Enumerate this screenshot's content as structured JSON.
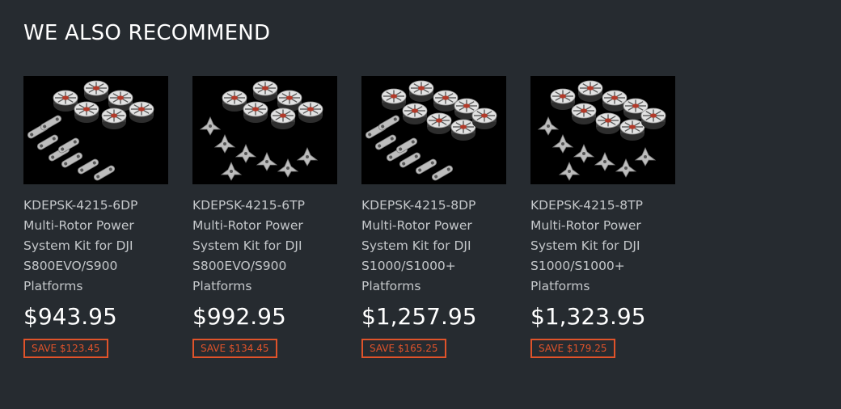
{
  "section": {
    "title": "WE ALSO RECOMMEND"
  },
  "colors": {
    "background": "#262b30",
    "save_badge": "#e0532a",
    "text_primary": "#ffffff",
    "text_secondary": "#c4c7ca"
  },
  "products": [
    {
      "image_icon": "motor-kit-image",
      "motors": 6,
      "arm_type": "DP",
      "name": "KDEPSK-4215-6DP Multi-Rotor Power System Kit for DJI S800EVO/S900 Platforms",
      "price": "$943.95",
      "save": "SAVE $123.45"
    },
    {
      "image_icon": "motor-kit-image",
      "motors": 6,
      "arm_type": "TP",
      "name": "KDEPSK-4215-6TP Multi-Rotor Power System Kit for DJI S800EVO/S900 Platforms",
      "price": "$992.95",
      "save": "SAVE $134.45"
    },
    {
      "image_icon": "motor-kit-image",
      "motors": 8,
      "arm_type": "DP",
      "name": "KDEPSK-4215-8DP Multi-Rotor Power System Kit for DJI S1000/S1000+ Platforms",
      "price": "$1,257.95",
      "save": "SAVE $165.25"
    },
    {
      "image_icon": "motor-kit-image",
      "motors": 8,
      "arm_type": "TP",
      "name": "KDEPSK-4215-8TP Multi-Rotor Power System Kit for DJI S1000/S1000+ Platforms",
      "price": "$1,323.95",
      "save": "SAVE $179.25"
    }
  ]
}
